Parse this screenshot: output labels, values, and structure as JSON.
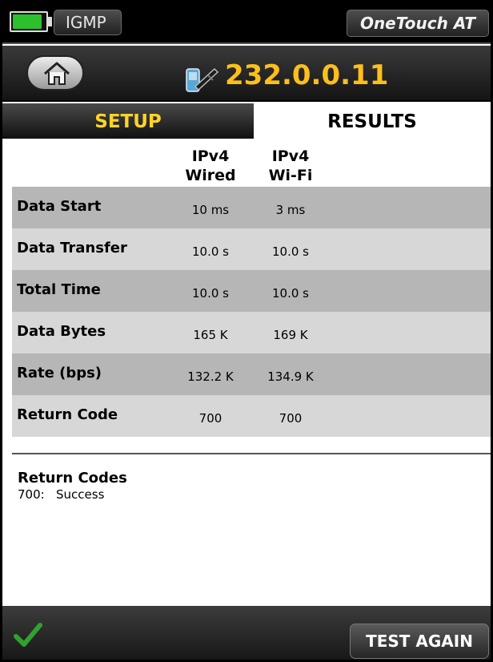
{
  "status_bar": {
    "test_type": "IGMP",
    "product": "OneTouch AT",
    "battery_level": 0.9,
    "battery_color": "#2cc12c"
  },
  "header": {
    "home_icon": "home-icon",
    "target_icon": "network-cable-icon",
    "target": "232.0.0.11",
    "target_color": "#ffbf1a"
  },
  "tabs": {
    "setup": "SETUP",
    "results": "RESULTS",
    "active": "results"
  },
  "columns": [
    {
      "line1": "IPv4",
      "line2": "Wired"
    },
    {
      "line1": "IPv4",
      "line2": "Wi-Fi"
    }
  ],
  "rows": [
    {
      "label": "Data Start",
      "wired": "10 ms",
      "wifi": "3 ms"
    },
    {
      "label": "Data Transfer",
      "wired": "10.0 s",
      "wifi": "10.0 s"
    },
    {
      "label": "Total Time",
      "wired": "10.0 s",
      "wifi": "10.0 s"
    },
    {
      "label": "Data Bytes",
      "wired": "165 K",
      "wifi": "169 K"
    },
    {
      "label": "Rate (bps)",
      "wired": "132.2 K",
      "wifi": "134.9 K"
    },
    {
      "label": "Return Code",
      "wired": "700",
      "wifi": "700"
    }
  ],
  "return_codes": {
    "title": "Return Codes",
    "entries": [
      {
        "code": "700:",
        "meaning": "Success"
      }
    ]
  },
  "footer": {
    "status_icon": "checkmark-icon",
    "status_color": "#2fa22f",
    "test_again": "TEST AGAIN"
  }
}
